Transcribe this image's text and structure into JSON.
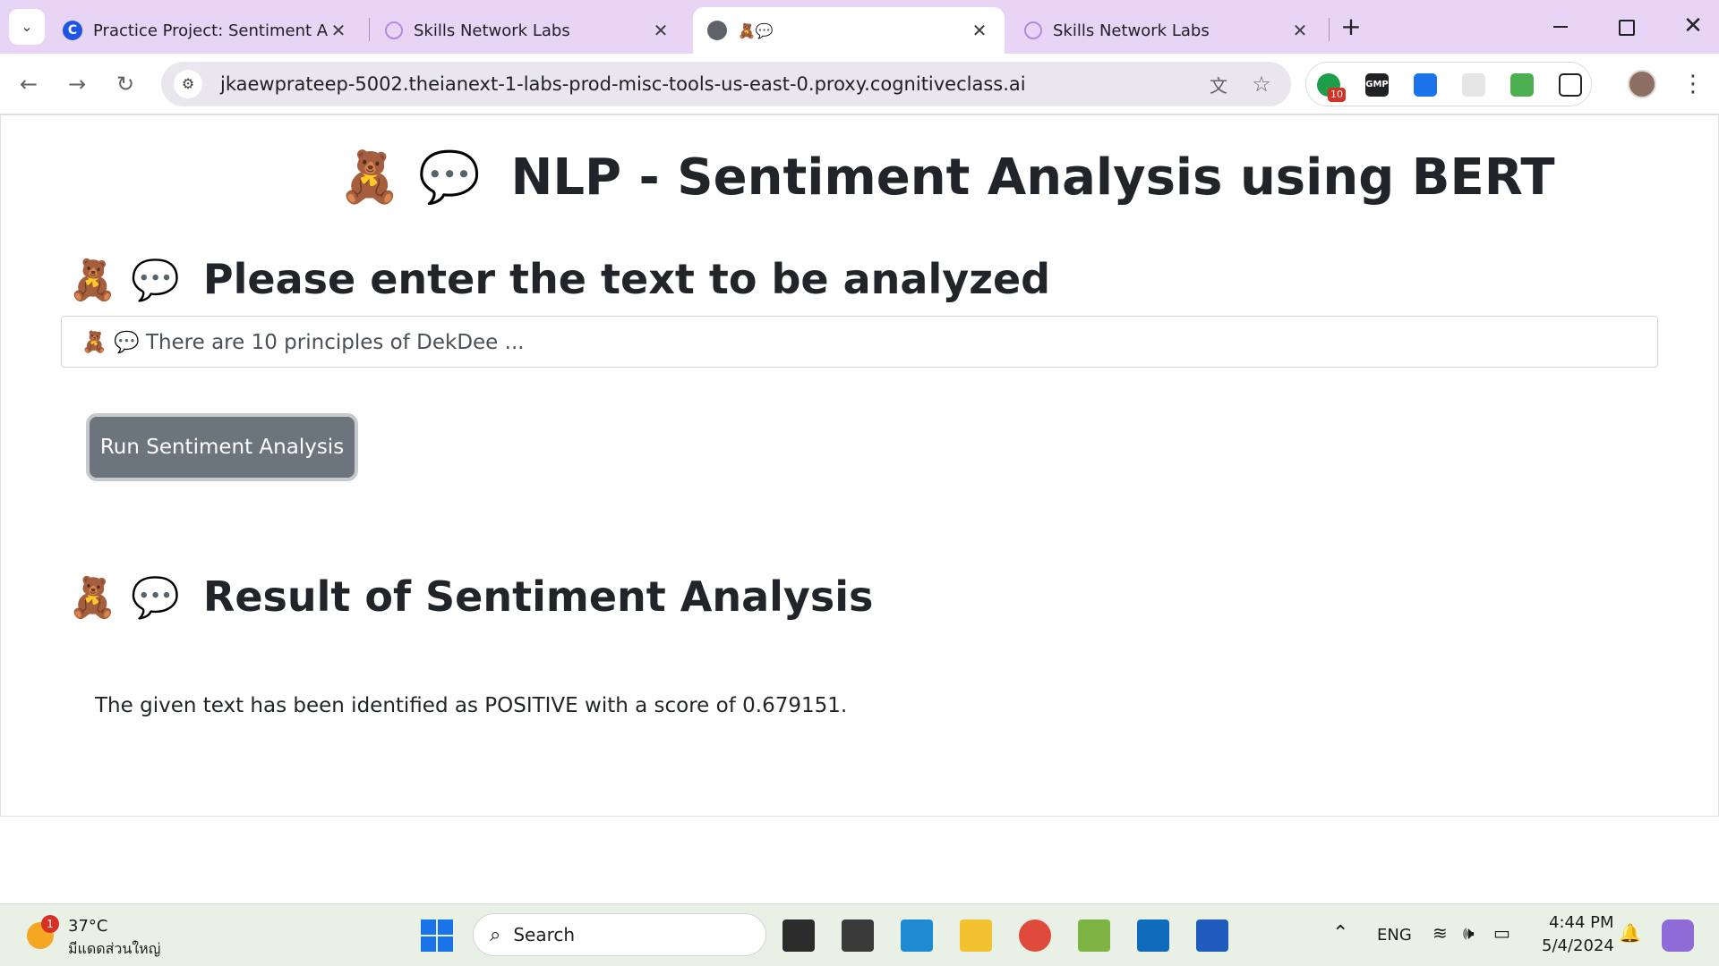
{
  "browser": {
    "tabs": [
      {
        "title": "Practice Project: Sentiment Ana",
        "icon": "coursera-icon",
        "close": "✕"
      },
      {
        "title": "Skills Network Labs",
        "icon": "skills-network-icon",
        "close": "✕"
      },
      {
        "title": "🧸💬",
        "icon": "globe-icon",
        "close": "✕"
      },
      {
        "title": "Skills Network Labs",
        "icon": "skills-network-icon",
        "close": "✕"
      }
    ],
    "new_tab": "+",
    "url": "jkaewprateep-5002.theianext-1-labs-prod-misc-tools-us-east-0.proxy.cognitiveclass.ai",
    "ext_badge": "10",
    "ext_gmp": "GMP"
  },
  "page": {
    "title_emoji": "🧸 💬",
    "title": "NLP - Sentiment Analysis using BERT",
    "input_heading": "Please enter the text to be analyzed",
    "input_value": "🧸 💬 There are 10 principles of DekDee ...",
    "run_button": "Run Sentiment Analysis",
    "result_heading": "Result of Sentiment Analysis",
    "result_text": "The given text has been identified as POSITIVE with a score of 0.679151."
  },
  "taskbar": {
    "weather_temp": "37°C",
    "weather_desc": "มีแดดส่วนใหญ่",
    "weather_badge": "1",
    "search_placeholder": "Search",
    "lang": "ENG",
    "time": "4:44 PM",
    "date": "5/4/2024"
  },
  "colors": {
    "tabstrip": "#e8d5f6",
    "button": "#6c757d",
    "taskbar": "#e9f1e6"
  }
}
